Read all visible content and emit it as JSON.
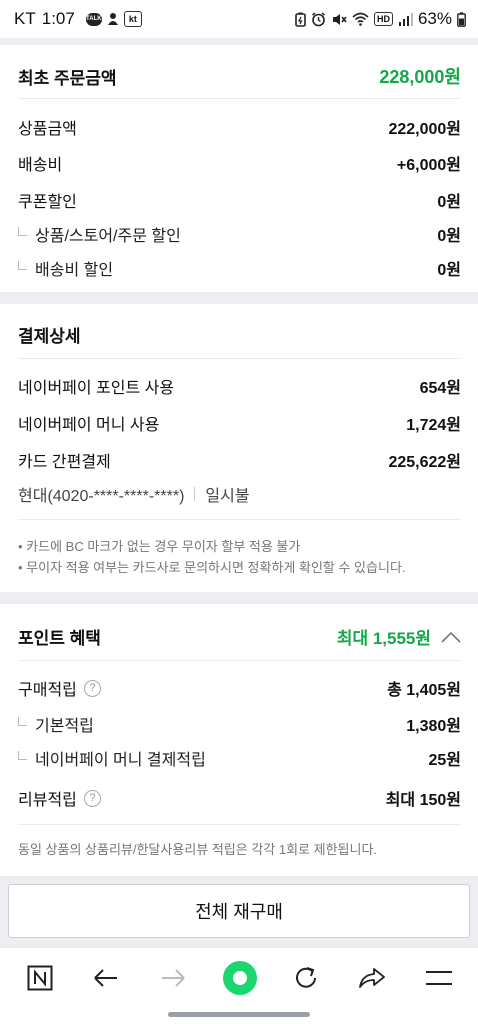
{
  "status_bar": {
    "carrier": "KT",
    "time": "1:07",
    "talk_badge": "TALK",
    "kt_badge": "kt",
    "hd_badge": "HD",
    "battery": "63%"
  },
  "order_summary": {
    "title": "최초 주문금액",
    "total": "228,000원",
    "rows": [
      {
        "label": "상품금액",
        "value": "222,000원"
      },
      {
        "label": "배송비",
        "value": "+6,000원"
      },
      {
        "label": "쿠폰할인",
        "value": "0원"
      },
      {
        "label": "상품/스토어/주문 할인",
        "value": "0원"
      },
      {
        "label": "배송비 할인",
        "value": "0원"
      }
    ]
  },
  "payment": {
    "title": "결제상세",
    "rows": [
      {
        "label": "네이버페이 포인트 사용",
        "value": "654원"
      },
      {
        "label": "네이버페이 머니 사용",
        "value": "1,724원"
      },
      {
        "label": "카드 간편결제",
        "value": "225,622원"
      }
    ],
    "card_info": "현대(4020-****-****-****)",
    "installment": "일시불",
    "notes": [
      "• 카드에 BC 마크가 없는 경우 무이자 할부 적용 불가",
      "• 무이자 적용 여부는 카드사로 문의하시면 정확하게 확인할 수 있습니다."
    ]
  },
  "points": {
    "title": "포인트 혜택",
    "max": "최대 1,555원",
    "purchase_label": "구매적립",
    "purchase_value": "총 1,405원",
    "basic_label": "기본적립",
    "basic_value": "1,380원",
    "money_label": "네이버페이 머니 결제적립",
    "money_value": "25원",
    "review_label": "리뷰적립",
    "review_value": "최대 150원",
    "note": "동일 상품의 상품리뷰/한달사용리뷰 적립은 각각 1회로 제한됩니다."
  },
  "rebuy_button": "전체 재구매",
  "colors": {
    "accent_green": "#16a64a",
    "background": "#eceef1"
  }
}
